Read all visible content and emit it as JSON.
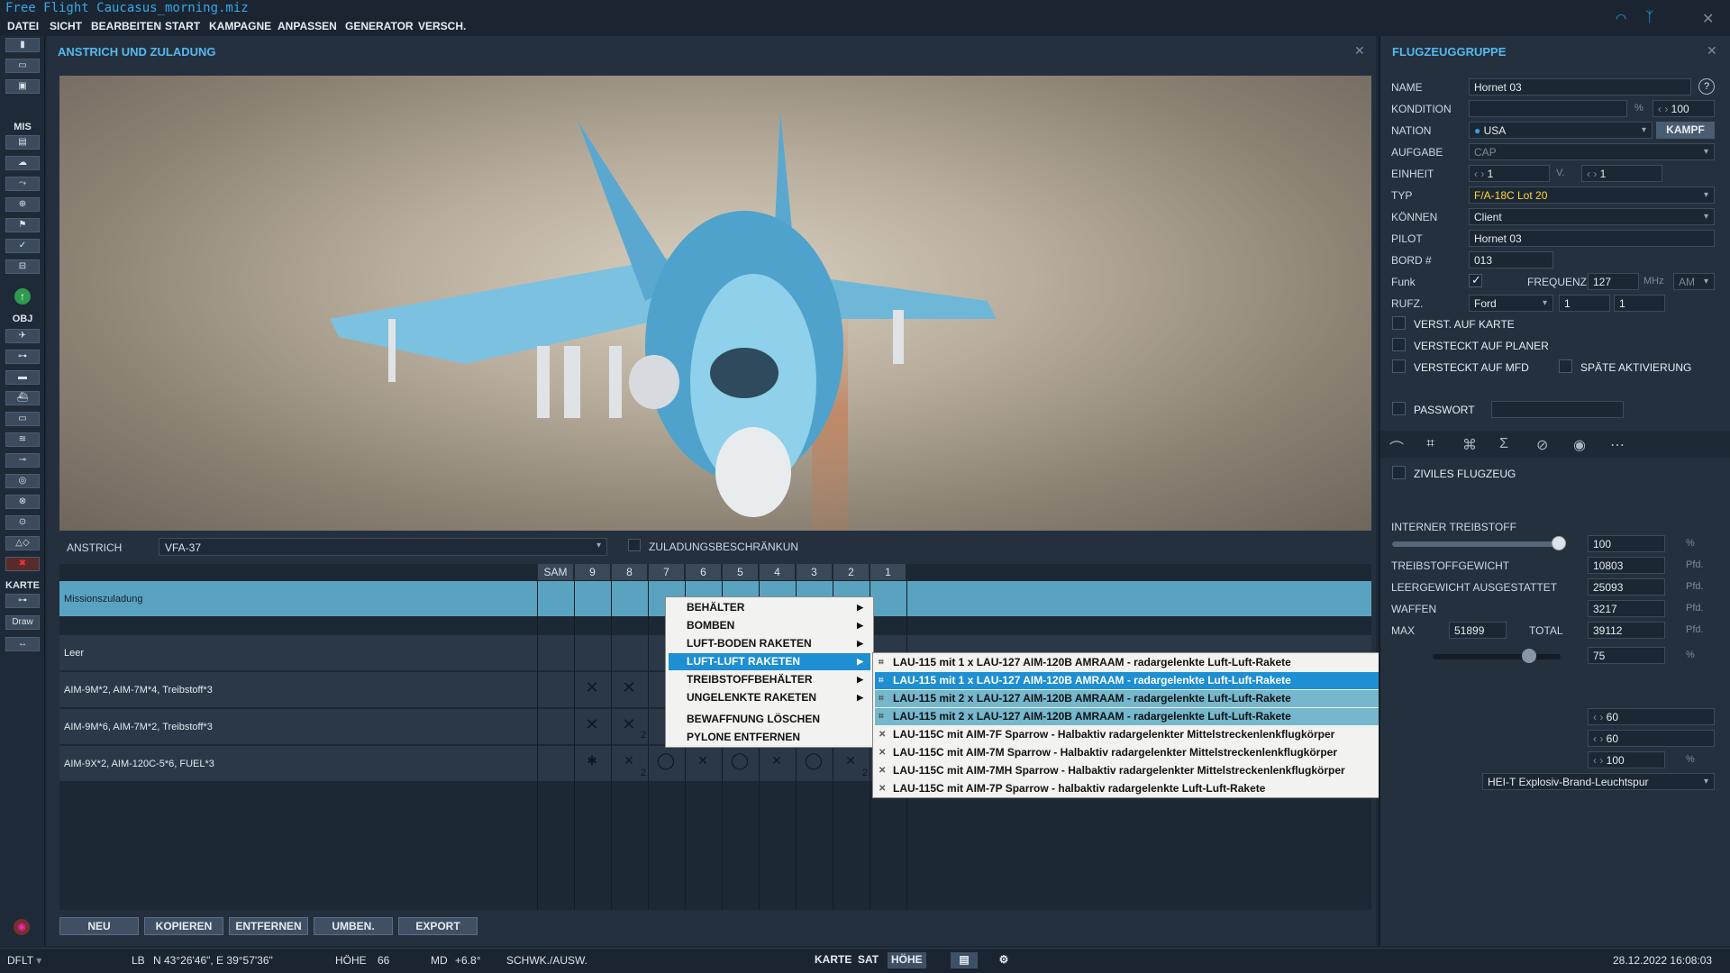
{
  "window": {
    "title": "Free Flight Caucasus_morning.miz"
  },
  "menu": [
    "DATEI",
    "SICHT",
    "BEARBEITEN",
    "START",
    "KAMPAGNE",
    "ANPASSEN",
    "GENERATOR",
    "VERSCH."
  ],
  "toolbar": {
    "mis_label": "MIS",
    "obj_label": "OBJ",
    "karte_label": "KARTE",
    "draw_label": "Draw"
  },
  "main": {
    "header": "ANSTRICH UND ZULADUNG",
    "livery_label": "ANSTRICH",
    "livery_value": "VFA-37",
    "loadout_restrict_label": "ZULADUNGSBESCHRÄNKUN",
    "columns": [
      "SAM",
      "9",
      "8",
      "7",
      "6",
      "5",
      "4",
      "3",
      "2",
      "1"
    ],
    "rows": [
      {
        "name": "Missionszuladung",
        "counts": {}
      },
      {
        "name": "Leer",
        "counts": {}
      },
      {
        "name": "AIM-9M*2, AIM-7M*4, Treibstoff*3",
        "counts": {}
      },
      {
        "name": "AIM-9M*6, AIM-7M*2, Treibstoff*3",
        "counts": {
          "8": "2"
        }
      },
      {
        "name": "AIM-9X*2, AIM-120C-5*6, FUEL*3",
        "counts": {
          "8": "2",
          "2": "2"
        }
      }
    ],
    "buttons": [
      "NEU",
      "KOPIEREN",
      "ENTFERNEN",
      "UMBEN.",
      "EXPORT"
    ]
  },
  "context_menu": {
    "items": [
      "BEHÄLTER",
      "BOMBEN",
      "LUFT-BODEN RAKETEN",
      "LUFT-LUFT RAKETEN",
      "TREIBSTOFFBEHÄLTER",
      "UNGELENKTE RAKETEN",
      "BEWAFFNUNG LÖSCHEN",
      "PYLONE ENTFERNEN"
    ],
    "submenu": [
      "LAU-115 mit 1 x LAU-127 AIM-120B AMRAAM - radargelenkte Luft-Luft-Rakete",
      "LAU-115 mit 1 x LAU-127 AIM-120B AMRAAM - radargelenkte Luft-Luft-Rakete",
      "LAU-115 mit 2 x LAU-127 AIM-120B AMRAAM - radargelenkte Luft-Luft-Rakete",
      "LAU-115 mit 2 x LAU-127 AIM-120B AMRAAM - radargelenkte Luft-Luft-Rakete",
      "LAU-115C mit AIM-7F Sparrow - Halbaktiv radargelenkter Mittelstreckenlenkflugkörper",
      "LAU-115C mit AIM-7M Sparrow - Halbaktiv radargelenkter Mittelstreckenlenkflugkörper",
      "LAU-115C mit AIM-7MH Sparrow - Halbaktiv radargelenkter Mittelstreckenlenkflugkörper",
      "LAU-115C mit AIM-7P Sparrow - halbaktiv radargelenkte Luft-Luft-Rakete"
    ]
  },
  "group": {
    "header": "FLUGZEUGGRUPPE",
    "help": "?",
    "labels": {
      "name": "NAME",
      "condition": "KONDITION",
      "nation": "NATION",
      "task": "AUFGABE",
      "unit": "EINHEIT",
      "type": "TYP",
      "skill": "KÖNNEN",
      "pilot": "PILOT",
      "board": "BORD #",
      "radio": "Funk",
      "freq": "FREQUENZ",
      "callsign": "RUFZ."
    },
    "name": "Hornet 03",
    "condition_pct": "%",
    "condition_value": "100",
    "nation": "USA",
    "coalition_button": "KAMPF",
    "task": "CAP",
    "unit_value": "1",
    "unit_of": "V.",
    "unit_total": "1",
    "type": "F/A-18C Lot 20",
    "skill": "Client",
    "pilot": "Hornet 03",
    "board": "013",
    "freq_value": "127",
    "freq_unit": "MHz",
    "modulation": "AM",
    "callsign_name": "Ford",
    "callsign_a": "1",
    "callsign_b": "1",
    "checks": {
      "hidden_map": "VERST. AUF KARTE",
      "hidden_planner": "VERSTECKT AUF PLANER",
      "hidden_mfd": "VERSTECKT AUF MFD",
      "late_activation": "SPÄTE AKTIVIERUNG",
      "password": "PASSWORT",
      "civil": "ZIVILES FLUGZEUG"
    },
    "fuel": {
      "internal_label": "INTERNER TREIBSTOFF",
      "internal_value": "100",
      "internal_unit": "%",
      "internal_fraction": 1.0,
      "weight_label": "TREIBSTOFFGEWICHT",
      "weight_value": "10803",
      "empty_label": "LEERGEWICHT AUSGESTATTET",
      "empty_value": "25093",
      "weapons_label": "WAFFEN",
      "weapons_value": "3217",
      "max_label": "MAX",
      "max_value": "51899",
      "total_label": "TOTAL",
      "total_value": "39112",
      "unit": "Pfd.",
      "second_value": "75",
      "second_unit": "%",
      "second_fraction": 0.75
    },
    "extra": {
      "v1": "60",
      "v2": "60",
      "v3": "100",
      "v3_unit": "%",
      "ammo": "HEI-T Explosiv-Brand-Leuchtspur"
    }
  },
  "status": {
    "profile": "DFLT",
    "coord_prefix": "LB",
    "coords": "N 43°26'46\", E 39°57'36\"",
    "alt_label": "HÖHE",
    "alt_value": "66",
    "md_label": "MD",
    "md_value": "+6.8°",
    "mode": "SCHWK./AUSW.",
    "view_buttons": [
      "KARTE",
      "SAT",
      "HÖHE"
    ],
    "datetime": "28.12.2022 16:08:03"
  },
  "colors": {
    "accent": "#57b8ee",
    "selection": "#1d8fd2",
    "mission_row": "#5aa3c0",
    "type_text": "#ffd93b"
  }
}
